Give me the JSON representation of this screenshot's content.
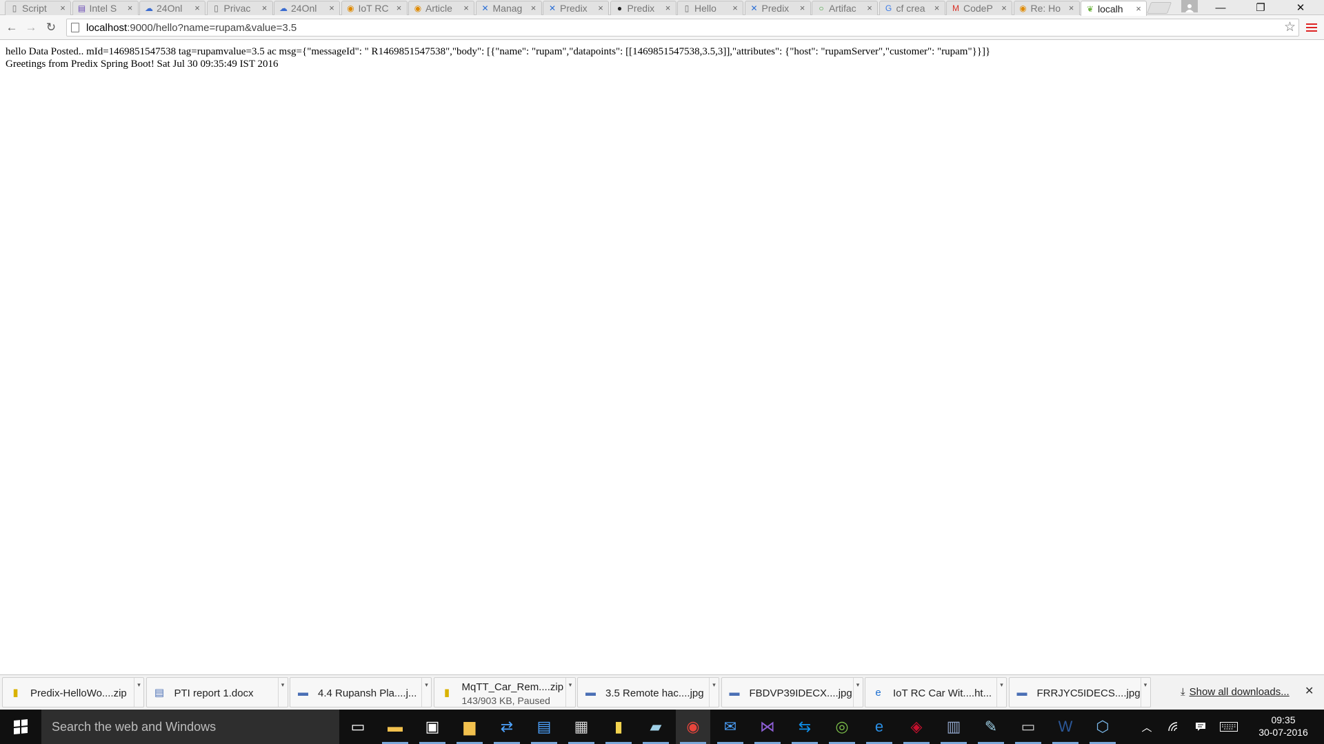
{
  "tabs": [
    {
      "title": "Script",
      "icon": "page-icon",
      "color": "#6f6f6f"
    },
    {
      "title": "Intel S",
      "icon": "intel-icon",
      "color": "#6b4bb5"
    },
    {
      "title": "24Onl",
      "icon": "cloud-icon",
      "color": "#3a6bd0"
    },
    {
      "title": "Privac",
      "icon": "page-icon",
      "color": "#6f6f6f"
    },
    {
      "title": "24Onl",
      "icon": "cloud-icon",
      "color": "#3a6bd0"
    },
    {
      "title": "IoT RC",
      "icon": "codeproject-icon",
      "color": "#e08a00"
    },
    {
      "title": "Article",
      "icon": "codeproject-icon",
      "color": "#e08a00"
    },
    {
      "title": "Manag",
      "icon": "predix-icon",
      "color": "#2b6fd6"
    },
    {
      "title": "Predix",
      "icon": "predix-icon",
      "color": "#2b6fd6"
    },
    {
      "title": "Predix",
      "icon": "github-icon",
      "color": "#222222"
    },
    {
      "title": "Hello",
      "icon": "page-icon",
      "color": "#6f6f6f"
    },
    {
      "title": "Predix",
      "icon": "predix-icon",
      "color": "#2b6fd6"
    },
    {
      "title": "Artifac",
      "icon": "artifactory-icon",
      "color": "#3fa23a"
    },
    {
      "title": "cf crea",
      "icon": "google-icon",
      "color": "#3b7be8"
    },
    {
      "title": "CodeP",
      "icon": "gmail-icon",
      "color": "#d93025"
    },
    {
      "title": "Re: Ho",
      "icon": "codeproject-icon",
      "color": "#e08a00"
    },
    {
      "title": "localh",
      "icon": "spring-leaf-icon",
      "color": "#6db33f",
      "active": true
    }
  ],
  "window_controls": {
    "minimize": "—",
    "restore": "❐",
    "close": "✕"
  },
  "toolbar": {
    "url_host": "localhost",
    "url_rest": ":9000/hello?name=rupam&value=3.5"
  },
  "page": {
    "line1": "hello Data Posted.. mId=1469851547538 tag=rupamvalue=3.5 ac msg={\"messageId\": \" R1469851547538\",\"body\": [{\"name\": \"rupam\",\"datapoints\": [[1469851547538,3.5,3]],\"attributes\": {\"host\": \"rupamServer\",\"customer\": \"rupam\"}}]}",
    "line2": "Greetings from Predix Spring Boot! Sat Jul 30 09:35:49 IST 2016"
  },
  "downloads": [
    {
      "name": "Predix-HelloWo....zip",
      "icon": "zip-icon",
      "color": "#d9b200"
    },
    {
      "name": "PTI report 1.docx",
      "icon": "document-icon",
      "color": "#4a6fb5"
    },
    {
      "name": "4.4 Rupansh Pla....j...",
      "icon": "image-icon",
      "color": "#4a6fb5"
    },
    {
      "name": "MqTT_Car_Rem....zip",
      "icon": "zip-icon",
      "color": "#d9b200",
      "status": "143/903 KB, Paused"
    },
    {
      "name": "3.5 Remote hac....jpg",
      "icon": "image-icon",
      "color": "#4a6fb5"
    },
    {
      "name": "FBDVP39IDECX....jpg",
      "icon": "image-icon",
      "color": "#4a6fb5"
    },
    {
      "name": "IoT RC Car Wit....ht...",
      "icon": "ie-document-icon",
      "color": "#1d6fd1"
    },
    {
      "name": "FRRJYC5IDECS....jpg",
      "icon": "image-icon",
      "color": "#4a6fb5"
    }
  ],
  "shelf": {
    "show_all": "Show all downloads..."
  },
  "taskbar": {
    "search_placeholder": "Search the web and Windows",
    "apps": [
      {
        "name": "task-view-icon",
        "color": "#ffffff"
      },
      {
        "name": "file-explorer-icon",
        "color": "#f2c14e"
      },
      {
        "name": "store-icon",
        "color": "#ffffff"
      },
      {
        "name": "folder-icon",
        "color": "#f2c14e"
      },
      {
        "name": "network-share-icon",
        "color": "#4da3ff"
      },
      {
        "name": "remote-desktop-icon",
        "color": "#4da3ff"
      },
      {
        "name": "printer-icon",
        "color": "#d0d0d0"
      },
      {
        "name": "sticky-notes-icon",
        "color": "#f2d34e"
      },
      {
        "name": "notepad-icon",
        "color": "#9fd0e6"
      },
      {
        "name": "chrome-icon",
        "color": "#e8453c",
        "active": true
      },
      {
        "name": "outlook-icon",
        "color": "#4da3ff"
      },
      {
        "name": "visual-studio-icon",
        "color": "#8e5fd6"
      },
      {
        "name": "teamviewer-icon",
        "color": "#0e8ee9"
      },
      {
        "name": "android-studio-icon",
        "color": "#7cbf4a"
      },
      {
        "name": "internet-explorer-icon",
        "color": "#2a8fe5"
      },
      {
        "name": "mcafee-icon",
        "color": "#c8102e"
      },
      {
        "name": "scanner-icon",
        "color": "#8fa3c7"
      },
      {
        "name": "paint-icon",
        "color": "#9fd0e6"
      },
      {
        "name": "command-prompt-icon",
        "color": "#cccccc"
      },
      {
        "name": "word-icon",
        "color": "#2b5797"
      },
      {
        "name": "virtualbox-icon",
        "color": "#7ab7e8"
      }
    ],
    "clock_time": "09:35",
    "clock_date": "30-07-2016"
  }
}
